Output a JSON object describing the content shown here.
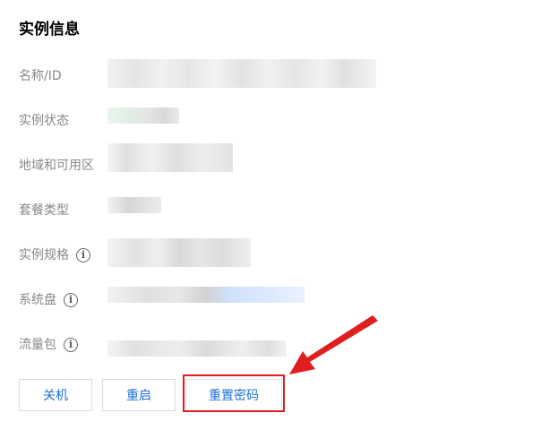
{
  "section": {
    "title": "实例信息"
  },
  "fields": {
    "name": "名称/ID",
    "status": "实例状态",
    "region": "地域和可用区",
    "plan_type": "套餐类型",
    "spec": "实例规格",
    "system_disk": "系统盘",
    "traffic_pack": "流量包"
  },
  "icons": {
    "info": "info-icon",
    "info_glyph": "i"
  },
  "buttons": {
    "shutdown": "关机",
    "restart": "重启",
    "reset_password": "重置密码"
  },
  "colors": {
    "accent_text": "#1e6fd9",
    "highlight": "#e01e1e",
    "arrow": "#e01e1e"
  }
}
